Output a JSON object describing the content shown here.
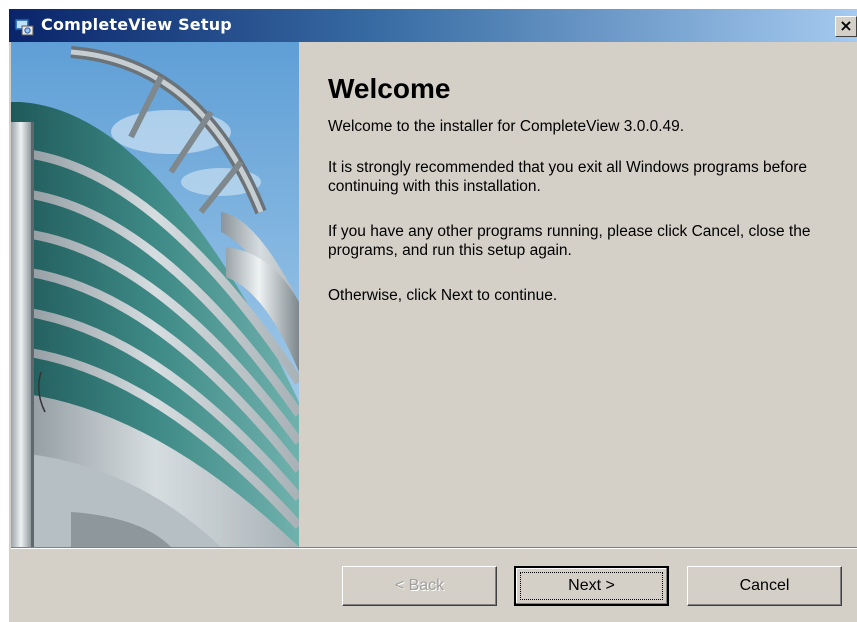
{
  "window": {
    "title": "CompleteView Setup",
    "close_glyph": "×",
    "title_icon": "setup-installer-icon"
  },
  "main": {
    "heading": "Welcome",
    "paragraphs": [
      "Welcome to the installer for CompleteView 3.0.0.49.",
      "It is strongly recommended that you exit all Windows programs before continuing with this installation.",
      "If you have any other programs running, please click Cancel, close the programs, and run this setup again.",
      "Otherwise, click Next to continue."
    ]
  },
  "buttons": {
    "back": "< Back",
    "next": "Next >",
    "cancel": "Cancel"
  },
  "banner": {
    "image": "glass-office-building-photo"
  }
}
